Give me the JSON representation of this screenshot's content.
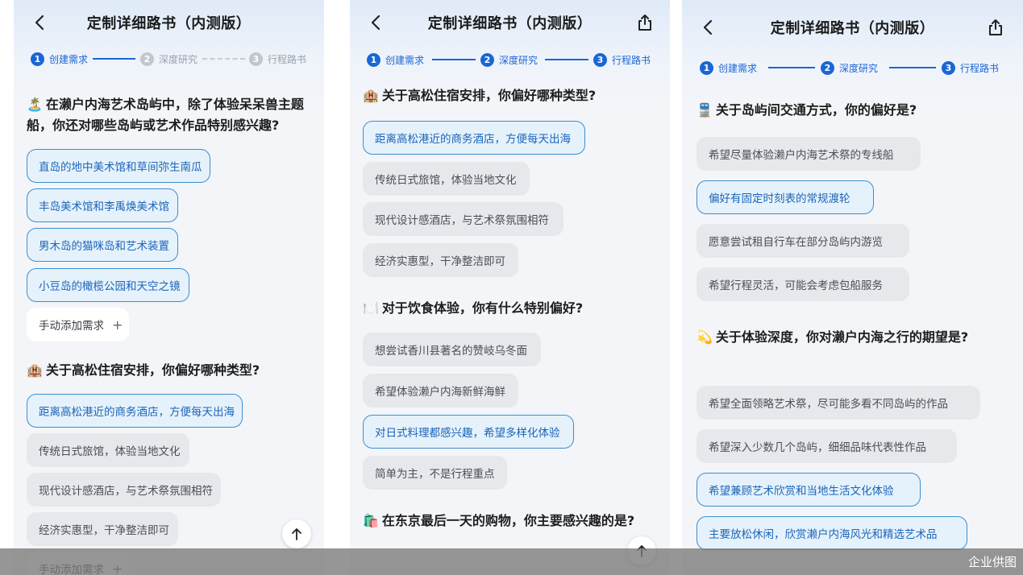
{
  "app": {
    "title": "定制详细路书（内测版）",
    "steps": [
      {
        "num": "1",
        "label": "创建需求"
      },
      {
        "num": "2",
        "label": "深度研究"
      },
      {
        "num": "3",
        "label": "行程路书"
      }
    ],
    "add_label": "手动添加需求",
    "add_icon": "plus-icon",
    "colors": {
      "accent": "#1a66d6",
      "selected_border": "#3a8fce",
      "selected_bg": "#e6f2fb",
      "option_bg": "#e6e8ec"
    }
  },
  "s1": {
    "q1": {
      "emoji": "🏝️",
      "text": "在濑户内海艺术岛屿中，除了体验呆呆兽主题船，你还对哪些岛屿或艺术作品特别感兴趣?",
      "options": [
        "直岛的地中美术馆和草间弥生南瓜",
        "丰岛美术馆和李禹焕美术馆",
        "男木岛的猫咪岛和艺术装置",
        "小豆岛的橄榄公园和天空之镜"
      ]
    },
    "q2": {
      "emoji": "🏨",
      "text": "关于高松住宿安排，你偏好哪种类型?",
      "options": [
        "距离高松港近的商务酒店，方便每天出海",
        "传统日式旅馆，体验当地文化",
        "现代设计感酒店，与艺术祭氛围相符",
        "经济实惠型，干净整洁即可"
      ]
    }
  },
  "s2": {
    "q1": {
      "emoji": "🏨",
      "text": "关于高松住宿安排，你偏好哪种类型?",
      "options": [
        "距离高松港近的商务酒店，方便每天出海",
        "传统日式旅馆，体验当地文化",
        "现代设计感酒店，与艺术祭氛围相符",
        "经济实惠型，干净整洁即可"
      ]
    },
    "q2": {
      "emoji": "🍽️",
      "text": "对于饮食体验，你有什么特别偏好?",
      "options": [
        "想尝试香川县著名的赞岐乌冬面",
        "希望体验濑户内海新鲜海鲜",
        "对日式料理都感兴趣，希望多样化体验",
        "简单为主，不是行程重点"
      ]
    },
    "q3": {
      "emoji": "🛍️",
      "text": "在东京最后一天的购物，你主要感兴趣的是?"
    }
  },
  "s3": {
    "q1": {
      "emoji": "🚆",
      "text": "关于岛屿间交通方式，你的偏好是?",
      "options": [
        "希望尽量体验濑户内海艺术祭的专线船",
        "偏好有固定时刻表的常规渡轮",
        "愿意尝试租自行车在部分岛屿内游览",
        "希望行程灵活，可能会考虑包船服务"
      ]
    },
    "q2": {
      "emoji": "💫",
      "text": "关于体验深度，你对濑户内海之行的期望是?",
      "options": [
        "希望全面领略艺术祭，尽可能多看不同岛屿的作品",
        "希望深入少数几个岛屿，细细品味代表性作品",
        "希望兼顾艺术欣赏和当地生活文化体验",
        "主要放松休闲，欣赏濑户内海风光和精选艺术品"
      ]
    }
  },
  "watermark": "企业供图"
}
